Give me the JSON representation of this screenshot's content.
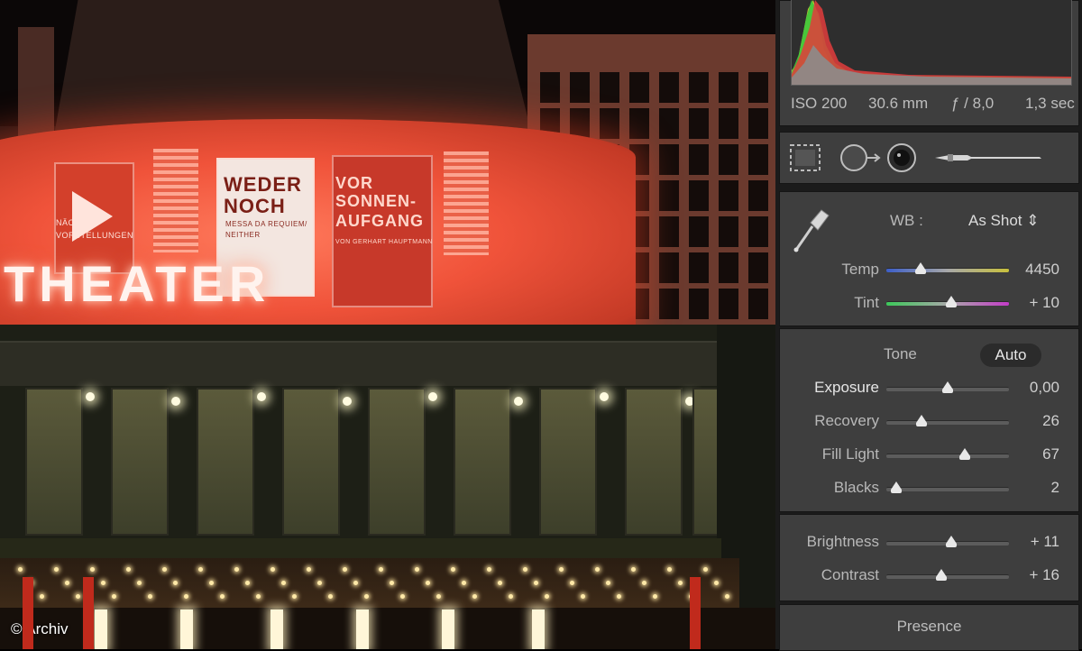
{
  "photo": {
    "sign_text": "THEATER",
    "poster_left": {
      "line1": "NÄCHSTE",
      "line2": "VORSTELLUNGEN"
    },
    "poster_middle": {
      "title1": "WEDER",
      "title2": "NOCH",
      "sub1": "MESSA DA REQUIEM/",
      "sub2": "NEITHER"
    },
    "poster_right": {
      "title1": "VOR",
      "title2": "SONNEN-",
      "title3": "AUFGANG",
      "sub": "VON GERHART HAUPTMANN"
    },
    "caption": "© Archiv"
  },
  "histogram": {
    "iso": "ISO 200",
    "focal_length": "30.6 mm",
    "aperture": "ƒ / 8,0",
    "shutter": "1,3 sec"
  },
  "tools": [
    "crop-overlay",
    "spot-removal",
    "red-eye",
    "adjustment-brush"
  ],
  "basic": {
    "wb_label": "WB :",
    "wb_value": "As Shot ⇕",
    "temp": {
      "label": "Temp",
      "value": "4450",
      "level": 0.28
    },
    "tint": {
      "label": "Tint",
      "value": "+ 10",
      "level": 0.53
    }
  },
  "tone": {
    "title": "Tone",
    "auto_label": "Auto",
    "sliders": [
      {
        "label": "Exposure",
        "value": "0,00",
        "level": 0.5
      },
      {
        "label": "Recovery",
        "value": "26",
        "level": 0.29
      },
      {
        "label": "Fill Light",
        "value": "67",
        "level": 0.64
      },
      {
        "label": "Blacks",
        "value": "2",
        "level": 0.08
      }
    ]
  },
  "presence_adjust": {
    "sliders": [
      {
        "label": "Brightness",
        "value": "+ 11",
        "level": 0.53
      },
      {
        "label": "Contrast",
        "value": "+ 16",
        "level": 0.45
      }
    ]
  },
  "presence": {
    "title": "Presence"
  }
}
